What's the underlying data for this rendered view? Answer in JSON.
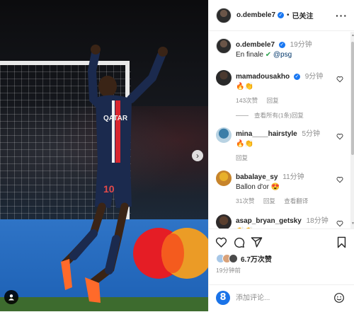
{
  "post": {
    "username": "o.dembele7",
    "follow_state": "已关注",
    "separator": "•",
    "more_label": "···",
    "caption": {
      "username": "o.dembele7",
      "time": "19分钟",
      "text_prefix": "En finale",
      "emoji": "✔",
      "tag": "@psg"
    }
  },
  "comments": [
    {
      "username": "mamadousakho",
      "verified": true,
      "time": "9分钟",
      "text": "🔥👏",
      "likes": "143次赞",
      "reply": "回复",
      "view_replies": "查看所有(1条)回复"
    },
    {
      "username": "mina____hairstyle",
      "verified": false,
      "time": "5分钟",
      "text": "🔥👏",
      "reply": "回复"
    },
    {
      "username": "babalaye_sy",
      "verified": false,
      "time": "11分钟",
      "text": "Ballon d'or 😍",
      "likes": "31次赞",
      "reply": "回复",
      "translate": "查看翻译"
    },
    {
      "username": "asap_bryan_getsky",
      "verified": false,
      "time": "18分钟",
      "text": "👏👏"
    }
  ],
  "engagement": {
    "likes": "6.7万次赞",
    "post_time": "19分钟前"
  },
  "add_comment": {
    "placeholder": "添加评论..."
  },
  "photo": {
    "jersey_sponsor": "QATAR",
    "jersey_number": "10"
  },
  "colors": {
    "verified_blue": "#1877f2",
    "link_blue": "#00376b",
    "psg_navy": "#1b2a4e",
    "mastercard_red": "#e51d25",
    "mastercard_orange": "#f69e1e"
  },
  "icons": {
    "heart": "heart-icon",
    "comment": "comment-icon",
    "share": "share-icon",
    "save": "save-icon",
    "more": "more-icon",
    "tag": "tag-user-icon",
    "next": "next-photo-icon",
    "emoji": "emoji-icon"
  }
}
